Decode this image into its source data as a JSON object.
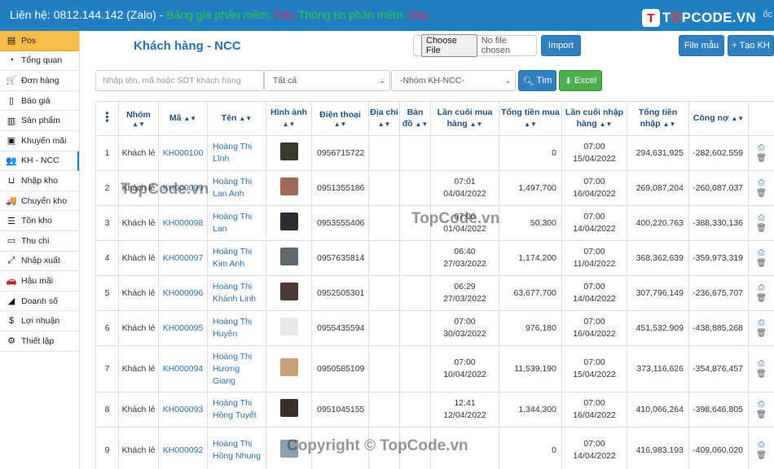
{
  "topbar": {
    "contact_label": "Liên hệ: 0812.144.142 (Zalo) - ",
    "price_label": "Bảng giá phần mềm: ",
    "price_link": "Đây",
    "info_label": " Thông tin phần mềm: ",
    "info_link": "Đây",
    "logo_mark": "T",
    "logo_text_pre": "T",
    "logo_text_o": "O",
    "logo_text_post": "PCODE.VN",
    "tail_text": "ốc"
  },
  "sidebar": {
    "items": [
      {
        "label": "Pos",
        "icon": "layers-icon"
      },
      {
        "label": "Tổng quan",
        "icon": "dashboard-icon"
      },
      {
        "label": "Đơn hàng",
        "icon": "cart-icon"
      },
      {
        "label": "Báo giá",
        "icon": "document-icon"
      },
      {
        "label": "Sản phẩm",
        "icon": "barcode-icon"
      },
      {
        "label": "Khuyến mãi",
        "icon": "qrcode-icon"
      },
      {
        "label": "KH - NCC",
        "icon": "users-icon"
      },
      {
        "label": "Nhập kho",
        "icon": "inbox-icon"
      },
      {
        "label": "Chuyển kho",
        "icon": "truck-icon"
      },
      {
        "label": "Tồn kho",
        "icon": "list-icon"
      },
      {
        "label": "Thu chi",
        "icon": "money-icon"
      },
      {
        "label": "Nhập xuất",
        "icon": "arrows-icon"
      },
      {
        "label": "Hậu mãi",
        "icon": "car-icon"
      },
      {
        "label": "Doanh số",
        "icon": "chart-icon"
      },
      {
        "label": "Lợi nhuận",
        "icon": "dollar-icon"
      },
      {
        "label": "Thiết lập",
        "icon": "gears-icon"
      }
    ]
  },
  "header": {
    "title": "Khách hàng - NCC",
    "choose_file": "Choose File",
    "no_file": "No file chosen",
    "import_label": "Import",
    "file_mau_label": "File mẫu",
    "tao_kh_label": "+ Tạo KH"
  },
  "filters": {
    "search_placeholder": "Nhập tên, mã hoặc SDT khách hàng",
    "select_all": "Tất cả",
    "select_group": "-Nhóm KH-NCC-",
    "tim_label": "Tìm",
    "excel_label": "Excel"
  },
  "table": {
    "headers": {
      "menu": "⋮",
      "group": "Nhóm",
      "code": "Mã",
      "name": "Tên",
      "image": "Hình ảnh",
      "phone": "Điện thoại",
      "address": "Địa chỉ",
      "map": "Bản đồ",
      "last_buy": "Lần cuối mua hàng",
      "total_buy": "Tổng tiền mua",
      "last_import": "Lần cuối nhập hàng",
      "total_import": "Tổng tiền nhập",
      "debt": "Công nợ"
    },
    "rows": [
      {
        "no": "1",
        "group": "Khách lẻ",
        "code": "KH000100",
        "name": "Hoàng Thị Lĩnh",
        "phone": "0956715722",
        "last_buy": "",
        "total_buy": "0",
        "last_import": "07:00 15/04/2022",
        "total_import": "294,631,925",
        "debt": "-282,602,559",
        "thumb": "#3a3a2a"
      },
      {
        "no": "2",
        "group": "Khách lẻ",
        "code": "KH000099",
        "name": "Hoàng Thị Lan Anh",
        "phone": "0951355186",
        "last_buy": "07:01 04/04/2022",
        "total_buy": "1,497,700",
        "last_import": "07:00 16/04/2022",
        "total_import": "269,087,204",
        "debt": "-260,087,037",
        "thumb": "#a06a5a"
      },
      {
        "no": "3",
        "group": "Khách lẻ",
        "code": "KH000098",
        "name": "Hoàng Thị Lan",
        "phone": "0953555406",
        "last_buy": "07:00 01/04/2022",
        "total_buy": "50,300",
        "last_import": "07:00 14/04/2022",
        "total_import": "400,220,763",
        "debt": "-388,330,136",
        "thumb": "#2b2b33"
      },
      {
        "no": "4",
        "group": "Khách lẻ",
        "code": "KH000097",
        "name": "Hoàng Thị Kim Anh",
        "phone": "0957635814",
        "last_buy": "06:40 27/03/2022",
        "total_buy": "1,174,200",
        "last_import": "07:00 11/04/2022",
        "total_import": "368,362,639",
        "debt": "-359,973,319",
        "thumb": "#5c6a70"
      },
      {
        "no": "5",
        "group": "Khách lẻ",
        "code": "KH000096",
        "name": "Hoàng Thị Khánh Linh",
        "phone": "0952505301",
        "last_buy": "06:29 27/03/2022",
        "total_buy": "63,677,700",
        "last_import": "07:00 14/04/2022",
        "total_import": "307,796,149",
        "debt": "-236,675,707",
        "thumb": "#4a3a30"
      },
      {
        "no": "6",
        "group": "Khách lẻ",
        "code": "KH000095",
        "name": "Hoàng Thị Huyền",
        "phone": "0955435594",
        "last_buy": "07:00 30/03/2022",
        "total_buy": "976,180",
        "last_import": "07:00 16/04/2022",
        "total_import": "451,532,909",
        "debt": "-438,885,268",
        "thumb": "#e8e8ea"
      },
      {
        "no": "7",
        "group": "Khách lẻ",
        "code": "KH000094",
        "name": "Hoàng Thị Hương Giang",
        "phone": "0950585109",
        "last_buy": "07:00 10/04/2022",
        "total_buy": "11,539,190",
        "last_import": "07:00 15/04/2022",
        "total_import": "373,116,626",
        "debt": "-354,876,457",
        "thumb": "#c8a07a"
      },
      {
        "no": "8",
        "group": "Khách lẻ",
        "code": "KH000093",
        "name": "Hoàng Thị Hồng Tuyết",
        "phone": "0951045155",
        "last_buy": "12:41 12/04/2022",
        "total_buy": "1,344,300",
        "last_import": "07:00 16/04/2022",
        "total_import": "410,066,264",
        "debt": "-398,646,805",
        "thumb": "#3a3228"
      },
      {
        "no": "9",
        "group": "Khách lẻ",
        "code": "KH000092",
        "name": "Hoàng Thị Hồng Nhung",
        "phone": "",
        "last_buy": "",
        "total_buy": "0",
        "last_import": "07:00 14/04/2022",
        "total_import": "416,983,193",
        "debt": "-409,060,020",
        "thumb": "#8aa0b0"
      }
    ]
  },
  "watermarks": {
    "wm1": "TopCode.vn",
    "wm2": "TopCode.vn",
    "wm3": "Copyright © TopCode.vn"
  }
}
